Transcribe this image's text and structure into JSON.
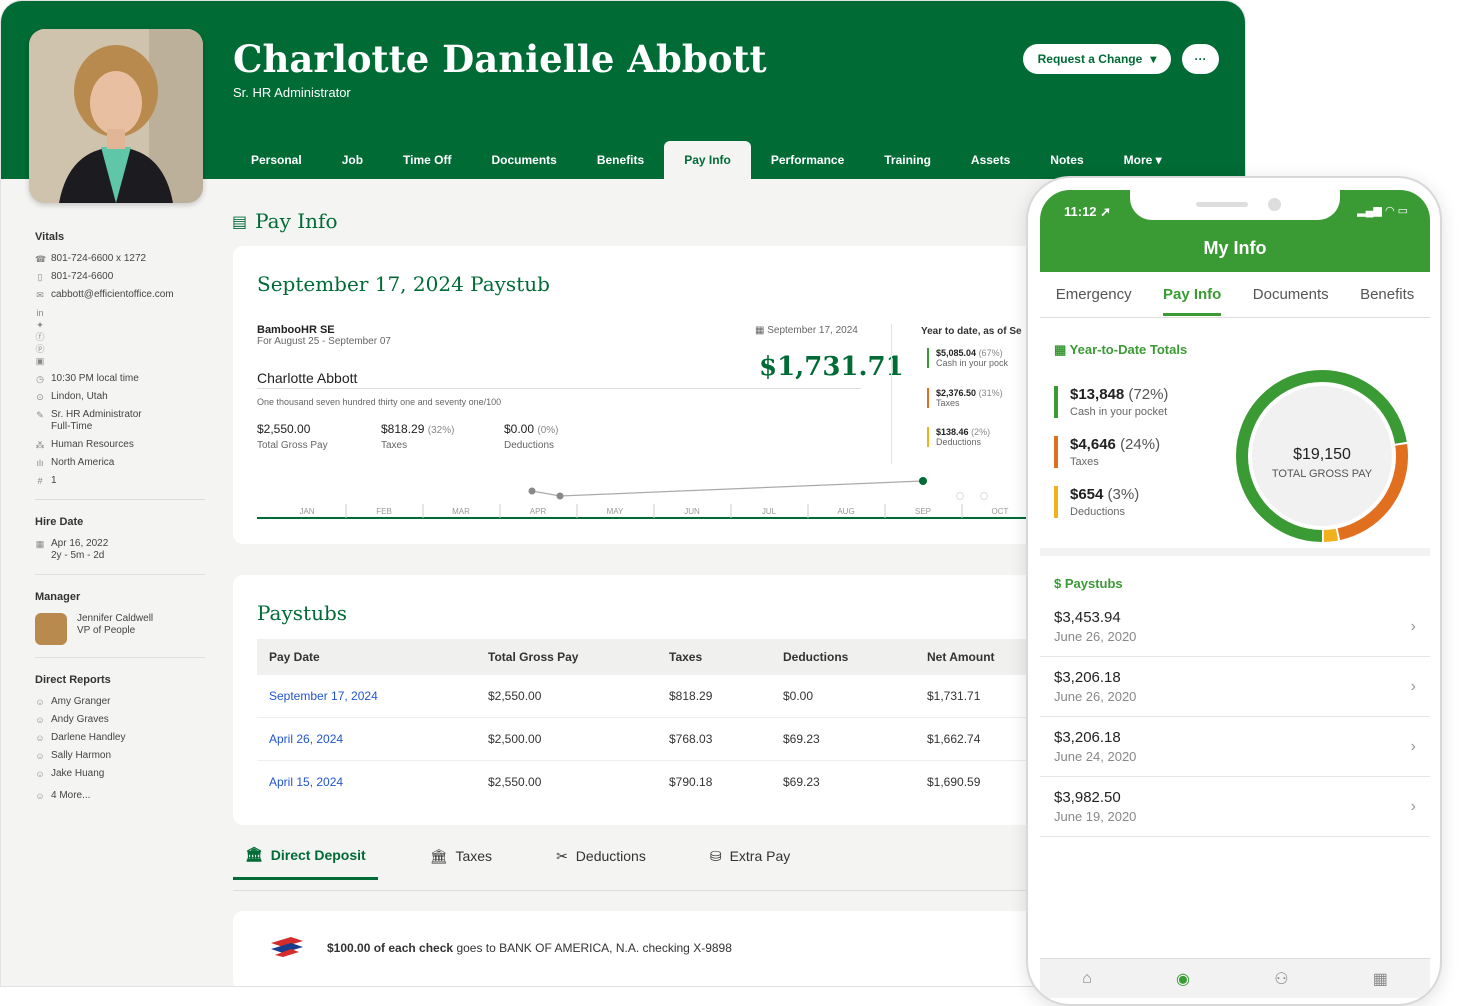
{
  "profile": {
    "name": "Charlotte Danielle Abbott",
    "role": "Sr. HR Administrator",
    "request_label": "Request a Change",
    "more_label": "···"
  },
  "tabs": [
    "Personal",
    "Job",
    "Time Off",
    "Documents",
    "Benefits",
    "Pay Info",
    "Performance",
    "Training",
    "Assets",
    "Notes",
    "More"
  ],
  "active_tab": "Pay Info",
  "sidebar": {
    "vitals_title": "Vitals",
    "vitals": [
      "801-724-6600 x 1272",
      "801-724-6600",
      "cabbott@efficientoffice.com",
      "10:30 PM local time",
      "Lindon, Utah",
      "Sr. HR Administrator",
      "Full-Time",
      "Human Resources",
      "North America",
      "1"
    ],
    "hire_title": "Hire Date",
    "hire_date": "Apr 16, 2022",
    "hire_len": "2y - 5m - 2d",
    "manager_title": "Manager",
    "manager_name": "Jennifer Caldwell",
    "manager_role": "VP of People",
    "reports_title": "Direct Reports",
    "reports": [
      "Amy Granger",
      "Andy Graves",
      "Darlene Handley",
      "Sally Harmon",
      "Jake Huang",
      "4 More..."
    ]
  },
  "page_title": "Pay Info",
  "paystub": {
    "title": "September 17, 2024 Paystub",
    "company": "BambooHR SE",
    "period": "For August 25 - September 07",
    "date": "September 17, 2024",
    "employee": "Charlotte Abbott",
    "net": "$1,731.71",
    "words": "One thousand seven hundred thirty one and seventy one/100",
    "gross": "$2,550.00",
    "gross_label": "Total Gross Pay",
    "taxes": "$818.29",
    "taxes_pct": "(32%)",
    "taxes_label": "Taxes",
    "ded": "$0.00",
    "ded_pct": "(0%)",
    "ded_label": "Deductions",
    "ytd_title": "Year to date, as of Se",
    "ytd": [
      {
        "v": "$5,085.04",
        "p": "(67%)",
        "l": "Cash in your pock"
      },
      {
        "v": "$2,376.50",
        "p": "(31%)",
        "l": "Taxes"
      },
      {
        "v": "$138.46",
        "p": "(2%)",
        "l": "Deductions"
      }
    ],
    "months": [
      "JAN",
      "FEB",
      "MAR",
      "APR",
      "MAY",
      "JUN",
      "JUL",
      "AUG",
      "SEP",
      "OCT"
    ]
  },
  "paystubs": {
    "title": "Paystubs",
    "headers": [
      "Pay Date",
      "Total Gross Pay",
      "Taxes",
      "Deductions",
      "Net Amount"
    ],
    "rows": [
      [
        "September 17, 2024",
        "$2,550.00",
        "$818.29",
        "$0.00",
        "$1,731.71"
      ],
      [
        "April 26, 2024",
        "$2,500.00",
        "$768.03",
        "$69.23",
        "$1,662.74"
      ],
      [
        "April 15, 2024",
        "$2,550.00",
        "$790.18",
        "$69.23",
        "$1,690.59"
      ]
    ]
  },
  "subtabs": [
    "Direct Deposit",
    "Taxes",
    "Deductions",
    "Extra Pay"
  ],
  "deposit": {
    "amount": "$100.00 of each check",
    "rest": "goes to BANK OF AMERICA, N.A. checking X-9898"
  },
  "phone": {
    "time": "11:12",
    "title": "My Info",
    "tabs": [
      "Emergency",
      "Pay Info",
      "Documents",
      "Benefits"
    ],
    "ytd_title": "Year-to-Date Totals",
    "ytd": [
      {
        "v": "$13,848",
        "p": "(72%)",
        "l": "Cash in your pocket",
        "color": "#3a9b34",
        "frac": 0.72
      },
      {
        "v": "$4,646",
        "p": "(24%)",
        "l": "Taxes",
        "color": "#e07020",
        "frac": 0.24
      },
      {
        "v": "$654",
        "p": "(3%)",
        "l": "Deductions",
        "color": "#f2b01e",
        "frac": 0.03
      }
    ],
    "total": "$19,150",
    "total_label": "TOTAL GROSS PAY",
    "paystubs_title": "Paystubs",
    "paystubs": [
      {
        "a": "$3,453.94",
        "d": "June 26, 2020"
      },
      {
        "a": "$3,206.18",
        "d": "June 26, 2020"
      },
      {
        "a": "$3,206.18",
        "d": "June 24, 2020"
      },
      {
        "a": "$3,982.50",
        "d": "June 19, 2020"
      }
    ]
  },
  "colors": {
    "brand": "#006b35",
    "phone_green": "#3a9b34",
    "taxes": "#e07020",
    "deductions": "#f2b01e",
    "link": "#2255cc"
  }
}
